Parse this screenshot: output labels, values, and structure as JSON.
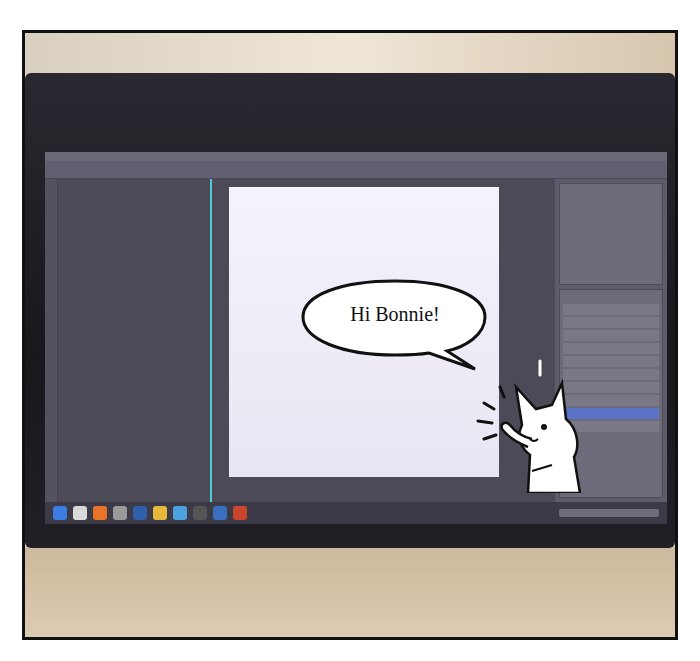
{
  "speech_bubble": {
    "text": "Hi Bonnie!"
  },
  "character": {
    "kind": "dog",
    "waving": true
  }
}
